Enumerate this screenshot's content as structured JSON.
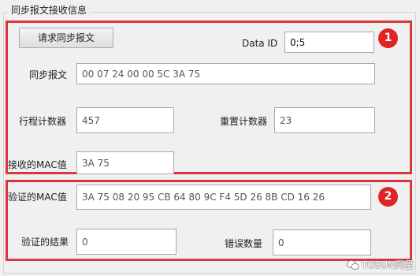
{
  "group": {
    "title": "同步报文接收信息"
  },
  "section1": {
    "badge": "1",
    "request_button": "请求同步报文",
    "data_id_label": "Data ID",
    "data_id_value": "0;5",
    "sync_msg_label": "同步报文",
    "sync_msg_value": "00 07 24 00 00 5C 3A 75",
    "trip_counter_label": "行程计数器",
    "trip_counter_value": "457",
    "reset_counter_label": "重置计数器",
    "reset_counter_value": "23",
    "received_mac_label": "接收的MAC值",
    "received_mac_value": "3A 75"
  },
  "section2": {
    "badge": "2",
    "verify_mac_label": "验证的MAC值",
    "verify_mac_value": "3A 75 08 20 95 CB 64 80 9C F4 5D 26 8B CD 16 26",
    "verify_result_label": "验证的结果",
    "verify_result_value": "0",
    "error_count_label": "错误数量",
    "error_count_value": "0"
  },
  "watermark": {
    "text": "TOSUN同星",
    "icon": "wechat-icon"
  }
}
